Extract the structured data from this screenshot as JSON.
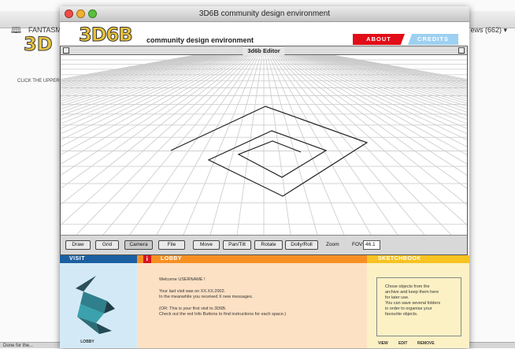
{
  "background": {
    "tab_label": "FANTASM",
    "right_toolbar": "ews (662) ▾",
    "left_text": "CLICK THE UPPER",
    "status_text": "Done for the..."
  },
  "window": {
    "title": "3D6B community design environment"
  },
  "header": {
    "logo": "3D6B",
    "tagline": "community design environment",
    "about": "ABOUT",
    "credits": "CREDITS"
  },
  "editor": {
    "title": "3d6b Editor",
    "toolbar": {
      "draw": "Draw",
      "grid": "Grid",
      "camera": "Camera",
      "file": "File",
      "move": "Move",
      "pantilt": "Pan/Tilt",
      "rotate": "Rotate",
      "dollyroll": "Dolly/Roll",
      "zoom": "Zoom",
      "fov_label": "FOV:",
      "fov_value": "46.1"
    }
  },
  "visit": {
    "header": "VISIT",
    "label": "LOBBY"
  },
  "lobby": {
    "header": "LOBBY",
    "welcome": "Welcome USERNAME !",
    "last_visit": "Your last visit was on XX.XX.2002.",
    "messages": "In the meanwhile you received X new messages.",
    "first_visit": "(OR: This is your first visit to 3D6B.",
    "instructions": "Check out the red Info Buttons to find instructions for each space.)"
  },
  "sketchbook": {
    "header": "SKETCHBOOK",
    "lines": [
      "Chose objects from the",
      "archive and keep them here",
      "for later use.",
      "You can save several folders",
      "in order to organise your",
      "favourite objects."
    ],
    "view": "VIEW",
    "edit": "EDIT",
    "remove": "REMOVE"
  },
  "colors": {
    "visit": "#1b5fa1",
    "lobby": "#f79023",
    "sketchbook": "#f7c322",
    "about": "#e10d17",
    "credits": "#9ed0f1"
  }
}
